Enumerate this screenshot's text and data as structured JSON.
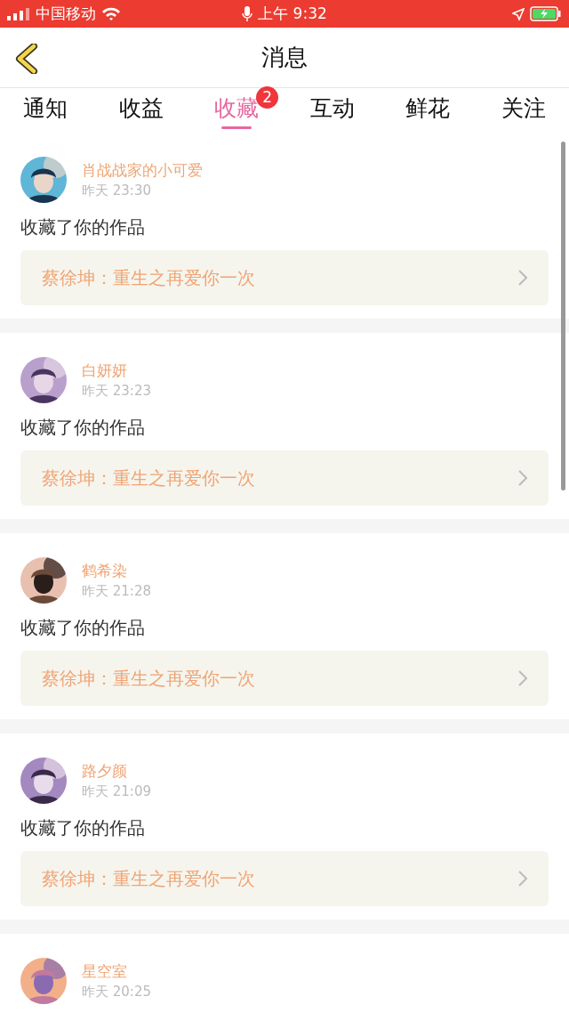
{
  "status_bar": {
    "carrier": "中国移动",
    "time": "上午 9:32"
  },
  "header": {
    "title": "消息"
  },
  "tabs": [
    {
      "label": "通知",
      "selected": false
    },
    {
      "label": "收益",
      "selected": false
    },
    {
      "label": "收藏",
      "selected": true,
      "badge": "2"
    },
    {
      "label": "互动",
      "selected": false
    },
    {
      "label": "鲜花",
      "selected": false
    },
    {
      "label": "关注",
      "selected": false
    }
  ],
  "messages": [
    {
      "name": "肖战战家的小可爱",
      "time": "昨天 23:30",
      "action": "收藏了你的作品",
      "work": "蔡徐坤：重生之再爱你一次"
    },
    {
      "name": "白妍妍",
      "time": "昨天 23:23",
      "action": "收藏了你的作品",
      "work": "蔡徐坤：重生之再爱你一次"
    },
    {
      "name": "鹤希染",
      "time": "昨天 21:28",
      "action": "收藏了你的作品",
      "work": "蔡徐坤：重生之再爱你一次"
    },
    {
      "name": "路夕颜",
      "time": "昨天 21:09",
      "action": "收藏了你的作品",
      "work": "蔡徐坤：重生之再爱你一次"
    },
    {
      "name": "星空室",
      "time": "昨天 20:25"
    }
  ]
}
